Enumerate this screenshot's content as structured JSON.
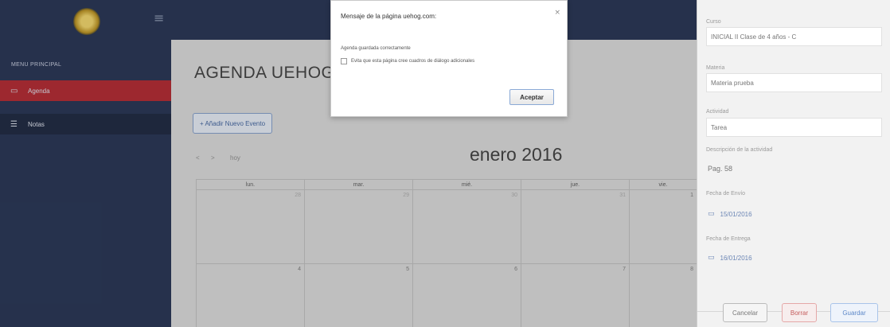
{
  "sidebar": {
    "heading": "MENU PRINCIPAL",
    "items": [
      {
        "label": "Agenda",
        "icon": "calendar-icon"
      },
      {
        "label": "Notas",
        "icon": "list-icon"
      }
    ]
  },
  "main": {
    "title": "AGENDA UEHOG",
    "add_event_label": "+ Añadir Nuevo Evento",
    "nav": {
      "prev": "<",
      "next": ">",
      "today": "hoy"
    },
    "month_title": "enero 2016",
    "weekdays": [
      "lun.",
      "mar.",
      "mié.",
      "jue.",
      "vie."
    ],
    "week1": [
      "28",
      "29",
      "30",
      "31",
      "1"
    ],
    "week2": [
      "4",
      "5",
      "6",
      "7",
      "8"
    ]
  },
  "dialog": {
    "title": "Mensaje de la página uehog.com:",
    "close": "×",
    "message": "Agenda guardada correctamente",
    "checkbox_label": "Evita que esta página cree cuadros de diálogo adicionales",
    "ok_label": "Aceptar"
  },
  "panel": {
    "curso_label": "Curso",
    "curso_value": "INICIAL II Clase de 4 años - C",
    "materia_label": "Materia",
    "materia_value": "Materia prueba",
    "actividad_label": "Actividad",
    "actividad_value": "Tarea",
    "descripcion_label": "Descripción de la actividad",
    "descripcion_value": "Pag. 58",
    "fecha_envio_label": "Fecha de Envío",
    "fecha_envio_value": "15/01/2016",
    "fecha_entrega_label": "Fecha de Entrega",
    "fecha_entrega_value": "16/01/2016",
    "cancel_label": "Cancelar",
    "delete_label": "Borrar",
    "save_label": "Guardar"
  },
  "colors": {
    "navbar": "#1f2d4e",
    "active_item": "#b0222a",
    "accent": "#3b5f9c"
  }
}
